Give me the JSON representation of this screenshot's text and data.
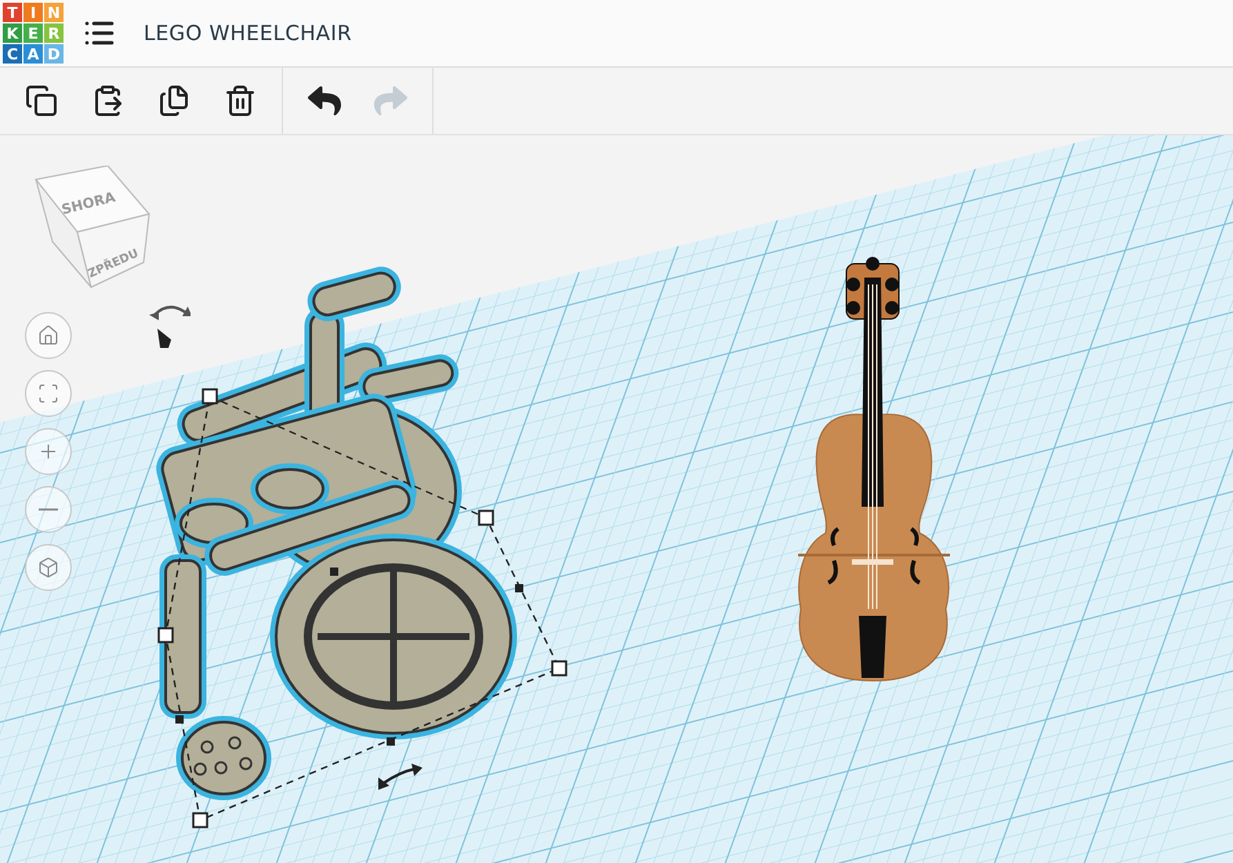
{
  "logo": {
    "letters": [
      {
        "text": "T",
        "color": "#e2412d"
      },
      {
        "text": "I",
        "color": "#f07a1e"
      },
      {
        "text": "N",
        "color": "#f5a23a"
      },
      {
        "text": "K",
        "color": "#2f9e44"
      },
      {
        "text": "E",
        "color": "#45b04a"
      },
      {
        "text": "R",
        "color": "#86c440"
      },
      {
        "text": "C",
        "color": "#1a6fb5"
      },
      {
        "text": "A",
        "color": "#2a8fd6"
      },
      {
        "text": "D",
        "color": "#6ab6e6"
      }
    ]
  },
  "title": "LEGO WHEELCHAIR",
  "toolbar": {
    "buttons": [
      {
        "kind": "copy",
        "disabled": false
      },
      {
        "kind": "paste",
        "disabled": false
      },
      {
        "kind": "duplicate",
        "disabled": false
      },
      {
        "kind": "delete",
        "disabled": false
      },
      {
        "kind": "undo",
        "disabled": false
      },
      {
        "kind": "redo",
        "disabled": true
      }
    ]
  },
  "view_cube": {
    "top": "SHORA",
    "front": "ZPŘEDU"
  },
  "nav_controls": [
    {
      "kind": "home"
    },
    {
      "kind": "fit"
    },
    {
      "kind": "zoom_in"
    },
    {
      "kind": "zoom_out"
    },
    {
      "kind": "projection"
    }
  ]
}
